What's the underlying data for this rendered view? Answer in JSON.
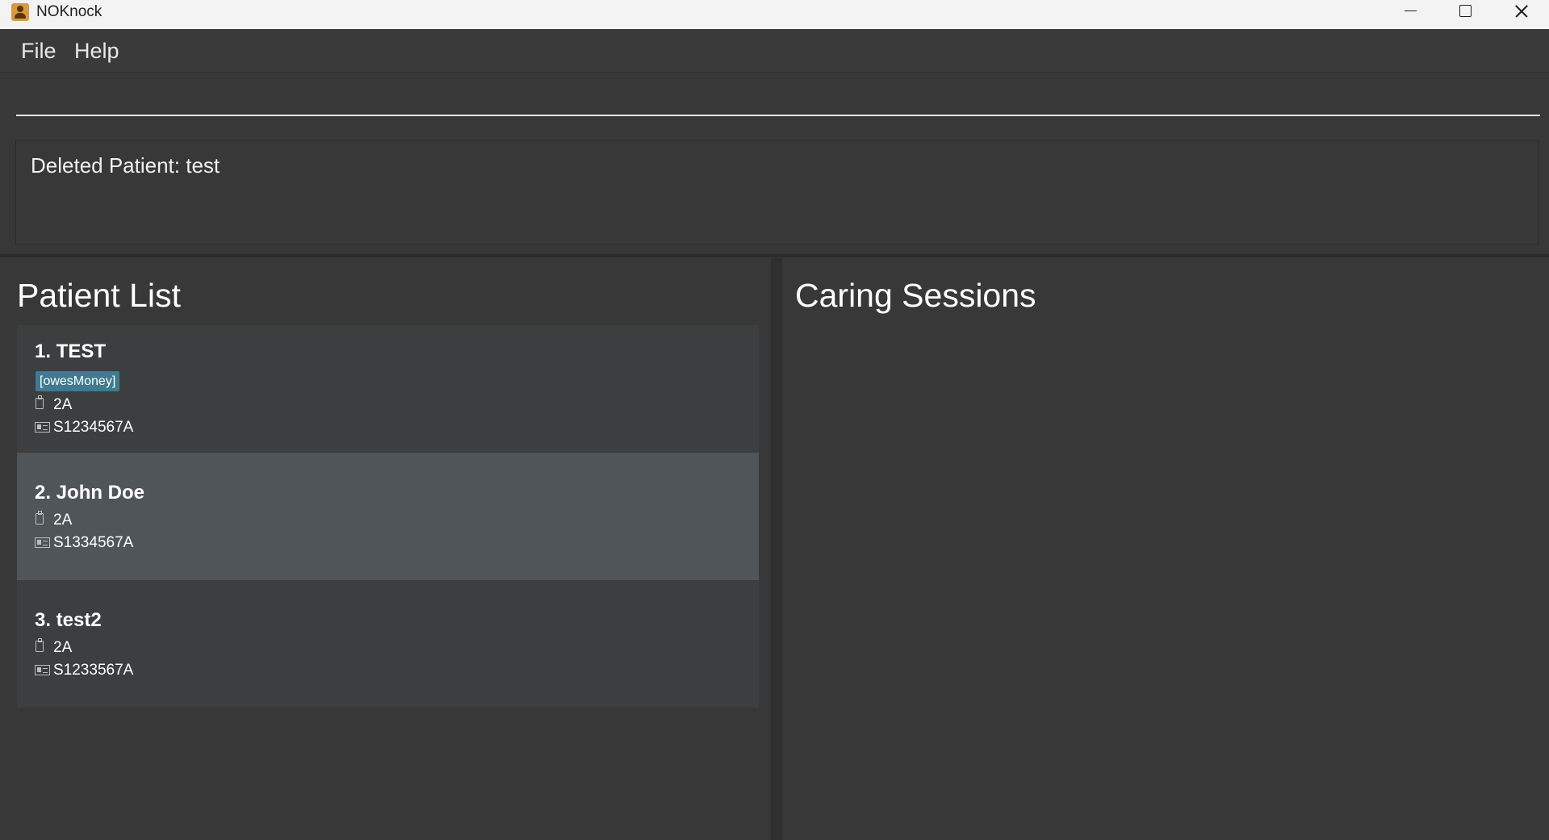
{
  "window": {
    "title": "NOKnock",
    "icon": "app-icon"
  },
  "menu": {
    "file_label": "File",
    "help_label": "Help"
  },
  "command_box": {
    "value": "",
    "placeholder": ""
  },
  "result_display": {
    "text": "Deleted Patient: test"
  },
  "patient_list": {
    "title": "Patient List",
    "patients": [
      {
        "index_name": "1. TEST",
        "tags": [
          "[owesMoney]"
        ],
        "ward": "2A",
        "ic": "S1234567A",
        "selected": false
      },
      {
        "index_name": "2. John Doe",
        "tags": [],
        "ward": "2A",
        "ic": "S1334567A",
        "selected": true
      },
      {
        "index_name": "3. test2",
        "tags": [],
        "ward": "2A",
        "ic": "S1233567A",
        "selected": false
      }
    ]
  },
  "caring_sessions": {
    "title": "Caring Sessions"
  },
  "colors": {
    "background": "#383838",
    "card": "#3c3e3f",
    "card_selected": "#4f5558",
    "tag": "#3e7b91"
  }
}
